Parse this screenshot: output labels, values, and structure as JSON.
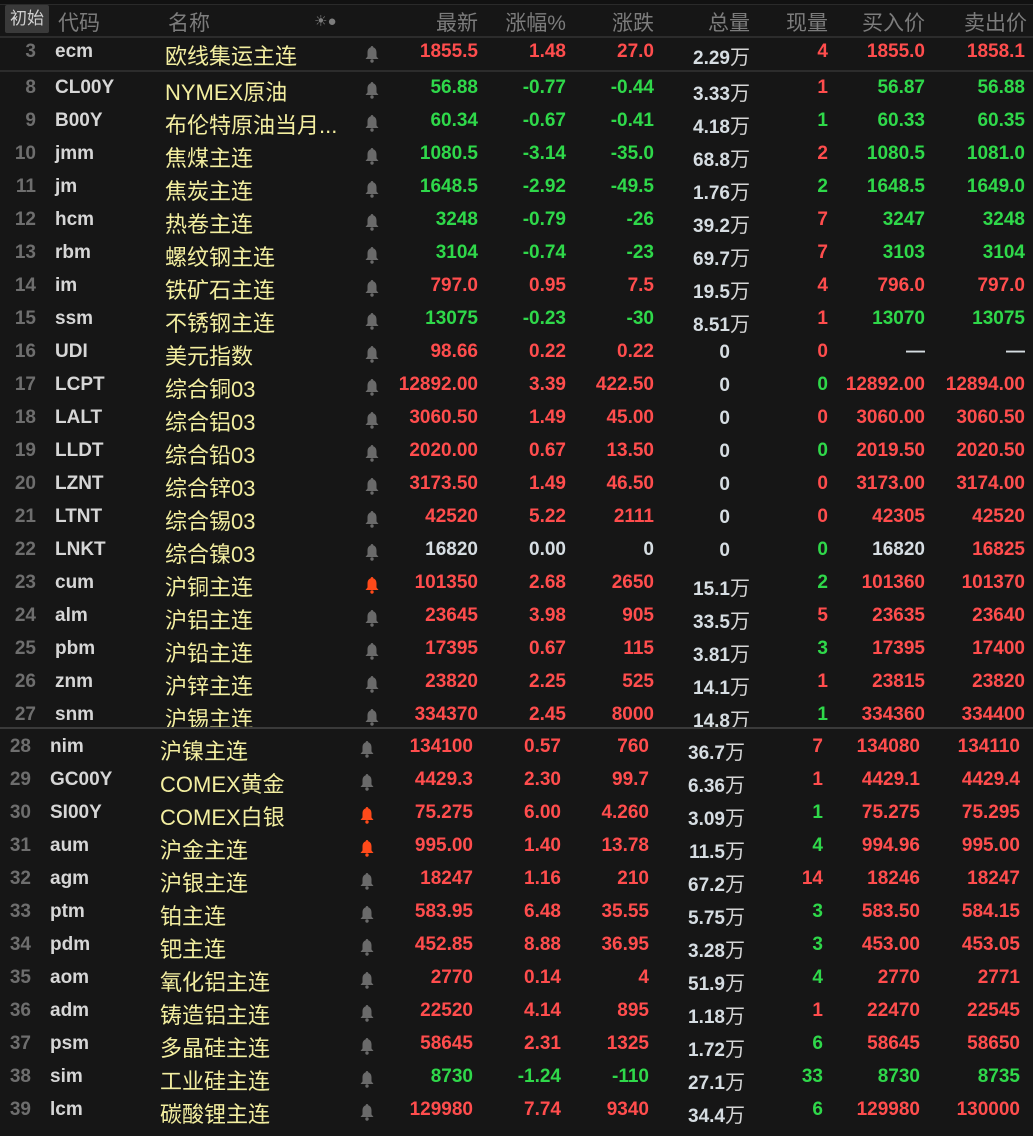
{
  "header": {
    "init_button": "初始",
    "code": "代码",
    "name": "名称",
    "icons": "☀●",
    "last": "最新",
    "pct": "涨幅%",
    "chg": "涨跌",
    "vol": "总量",
    "cur": "现量",
    "bid": "买入价",
    "ask": "卖出价"
  },
  "colors": {
    "up": "#ff4d4d",
    "down": "#2fd84a",
    "flat": "#d6dde2",
    "bell_gray": "#6a6a6a",
    "bell_alert": "#ff4a1a"
  },
  "rows": [
    {
      "idx": "3",
      "code": "ecm",
      "name": "欧线集运主连",
      "bell": "gray",
      "last": "1855.5",
      "pct": "1.48",
      "chg": "27.0",
      "vol": "2.29",
      "unit": "万",
      "cur": "4",
      "bid": "1855.0",
      "ask": "1858.1",
      "c": "rrrrrr"
    },
    {
      "idx": "8",
      "code": "CL00Y",
      "name": "NYMEX原油",
      "bell": "gray",
      "last": "56.88",
      "pct": "-0.77",
      "chg": "-0.44",
      "vol": "3.33",
      "unit": "万",
      "cur": "1",
      "bid": "56.87",
      "ask": "56.88",
      "c": "gggrgg"
    },
    {
      "idx": "9",
      "code": "B00Y",
      "name": "布伦特原油当月...",
      "bell": "gray",
      "last": "60.34",
      "pct": "-0.67",
      "chg": "-0.41",
      "vol": "4.18",
      "unit": "万",
      "cur": "1",
      "bid": "60.33",
      "ask": "60.35",
      "c": "gggggg"
    },
    {
      "idx": "10",
      "code": "jmm",
      "name": "焦煤主连",
      "bell": "gray",
      "last": "1080.5",
      "pct": "-3.14",
      "chg": "-35.0",
      "vol": "68.8",
      "unit": "万",
      "cur": "2",
      "bid": "1080.5",
      "ask": "1081.0",
      "c": "gggrgg"
    },
    {
      "idx": "11",
      "code": "jm",
      "name": "焦炭主连",
      "bell": "gray",
      "last": "1648.5",
      "pct": "-2.92",
      "chg": "-49.5",
      "vol": "1.76",
      "unit": "万",
      "cur": "2",
      "bid": "1648.5",
      "ask": "1649.0",
      "c": "gggggg"
    },
    {
      "idx": "12",
      "code": "hcm",
      "name": "热卷主连",
      "bell": "gray",
      "last": "3248",
      "pct": "-0.79",
      "chg": "-26",
      "vol": "39.2",
      "unit": "万",
      "cur": "7",
      "bid": "3247",
      "ask": "3248",
      "c": "gggrgg"
    },
    {
      "idx": "13",
      "code": "rbm",
      "name": "螺纹钢主连",
      "bell": "gray",
      "last": "3104",
      "pct": "-0.74",
      "chg": "-23",
      "vol": "69.7",
      "unit": "万",
      "cur": "7",
      "bid": "3103",
      "ask": "3104",
      "c": "gggrgg"
    },
    {
      "idx": "14",
      "code": "im",
      "name": "铁矿石主连",
      "bell": "gray",
      "last": "797.0",
      "pct": "0.95",
      "chg": "7.5",
      "vol": "19.5",
      "unit": "万",
      "cur": "4",
      "bid": "796.0",
      "ask": "797.0",
      "c": "rrrrrr"
    },
    {
      "idx": "15",
      "code": "ssm",
      "name": "不锈钢主连",
      "bell": "gray",
      "last": "13075",
      "pct": "-0.23",
      "chg": "-30",
      "vol": "8.51",
      "unit": "万",
      "cur": "1",
      "bid": "13070",
      "ask": "13075",
      "c": "gggrgg"
    },
    {
      "idx": "16",
      "code": "UDI",
      "name": "美元指数",
      "bell": "gray",
      "last": "98.66",
      "pct": "0.22",
      "chg": "0.22",
      "vol": "0",
      "unit": "",
      "cur": "0",
      "bid": "—",
      "ask": "—",
      "c": "rrrrww"
    },
    {
      "idx": "17",
      "code": "LCPT",
      "name": "综合铜03",
      "bell": "gray",
      "last": "12892.00",
      "pct": "3.39",
      "chg": "422.50",
      "vol": "0",
      "unit": "",
      "cur": "0",
      "bid": "12892.00",
      "ask": "12894.00",
      "c": "rrrgrr"
    },
    {
      "idx": "18",
      "code": "LALT",
      "name": "综合铝03",
      "bell": "gray",
      "last": "3060.50",
      "pct": "1.49",
      "chg": "45.00",
      "vol": "0",
      "unit": "",
      "cur": "0",
      "bid": "3060.00",
      "ask": "3060.50",
      "c": "rrrrrr"
    },
    {
      "idx": "19",
      "code": "LLDT",
      "name": "综合铅03",
      "bell": "gray",
      "last": "2020.00",
      "pct": "0.67",
      "chg": "13.50",
      "vol": "0",
      "unit": "",
      "cur": "0",
      "bid": "2019.50",
      "ask": "2020.50",
      "c": "rrrgrr"
    },
    {
      "idx": "20",
      "code": "LZNT",
      "name": "综合锌03",
      "bell": "gray",
      "last": "3173.50",
      "pct": "1.49",
      "chg": "46.50",
      "vol": "0",
      "unit": "",
      "cur": "0",
      "bid": "3173.00",
      "ask": "3174.00",
      "c": "rrrrrr"
    },
    {
      "idx": "21",
      "code": "LTNT",
      "name": "综合锡03",
      "bell": "gray",
      "last": "42520",
      "pct": "5.22",
      "chg": "2111",
      "vol": "0",
      "unit": "",
      "cur": "0",
      "bid": "42305",
      "ask": "42520",
      "c": "rrrrrr"
    },
    {
      "idx": "22",
      "code": "LNKT",
      "name": "综合镍03",
      "bell": "gray",
      "last": "16820",
      "pct": "0.00",
      "chg": "0",
      "vol": "0",
      "unit": "",
      "cur": "0",
      "bid": "16820",
      "ask": "16825",
      "c": "wwwgwr"
    },
    {
      "idx": "23",
      "code": "cum",
      "name": "沪铜主连",
      "bell": "alert",
      "last": "101350",
      "pct": "2.68",
      "chg": "2650",
      "vol": "15.1",
      "unit": "万",
      "cur": "2",
      "bid": "101360",
      "ask": "101370",
      "c": "rrrgrr"
    },
    {
      "idx": "24",
      "code": "alm",
      "name": "沪铝主连",
      "bell": "gray",
      "last": "23645",
      "pct": "3.98",
      "chg": "905",
      "vol": "33.5",
      "unit": "万",
      "cur": "5",
      "bid": "23635",
      "ask": "23640",
      "c": "rrrrrr"
    },
    {
      "idx": "25",
      "code": "pbm",
      "name": "沪铅主连",
      "bell": "gray",
      "last": "17395",
      "pct": "0.67",
      "chg": "115",
      "vol": "3.81",
      "unit": "万",
      "cur": "3",
      "bid": "17395",
      "ask": "17400",
      "c": "rrrgrr"
    },
    {
      "idx": "26",
      "code": "znm",
      "name": "沪锌主连",
      "bell": "gray",
      "last": "23820",
      "pct": "2.25",
      "chg": "525",
      "vol": "14.1",
      "unit": "万",
      "cur": "1",
      "bid": "23815",
      "ask": "23820",
      "c": "rrrrrr"
    },
    {
      "idx": "27",
      "code": "snm",
      "name": "沪锡主连",
      "bell": "gray",
      "last": "334370",
      "pct": "2.45",
      "chg": "8000",
      "vol": "14.8",
      "unit": "万",
      "cur": "1",
      "bid": "334360",
      "ask": "334400",
      "c": "rrrgrr"
    },
    {
      "idx": "28",
      "code": "nim",
      "name": "沪镍主连",
      "bell": "gray",
      "last": "134100",
      "pct": "0.57",
      "chg": "760",
      "vol": "36.7",
      "unit": "万",
      "cur": "7",
      "bid": "134080",
      "ask": "134110",
      "c": "rrrrrr"
    },
    {
      "idx": "29",
      "code": "GC00Y",
      "name": "COMEX黄金",
      "bell": "gray",
      "last": "4429.3",
      "pct": "2.30",
      "chg": "99.7",
      "vol": "6.36",
      "unit": "万",
      "cur": "1",
      "bid": "4429.1",
      "ask": "4429.4",
      "c": "rrrrrr"
    },
    {
      "idx": "30",
      "code": "SI00Y",
      "name": "COMEX白银",
      "bell": "alert",
      "last": "75.275",
      "pct": "6.00",
      "chg": "4.260",
      "vol": "3.09",
      "unit": "万",
      "cur": "1",
      "bid": "75.275",
      "ask": "75.295",
      "c": "rrrgrr"
    },
    {
      "idx": "31",
      "code": "aum",
      "name": "沪金主连",
      "bell": "alert",
      "last": "995.00",
      "pct": "1.40",
      "chg": "13.78",
      "vol": "11.5",
      "unit": "万",
      "cur": "4",
      "bid": "994.96",
      "ask": "995.00",
      "c": "rrrgrr"
    },
    {
      "idx": "32",
      "code": "agm",
      "name": "沪银主连",
      "bell": "gray",
      "last": "18247",
      "pct": "1.16",
      "chg": "210",
      "vol": "67.2",
      "unit": "万",
      "cur": "14",
      "bid": "18246",
      "ask": "18247",
      "c": "rrrrrr"
    },
    {
      "idx": "33",
      "code": "ptm",
      "name": "铂主连",
      "bell": "gray",
      "last": "583.95",
      "pct": "6.48",
      "chg": "35.55",
      "vol": "5.75",
      "unit": "万",
      "cur": "3",
      "bid": "583.50",
      "ask": "584.15",
      "c": "rrrgrr"
    },
    {
      "idx": "34",
      "code": "pdm",
      "name": "钯主连",
      "bell": "gray",
      "last": "452.85",
      "pct": "8.88",
      "chg": "36.95",
      "vol": "3.28",
      "unit": "万",
      "cur": "3",
      "bid": "453.00",
      "ask": "453.05",
      "c": "rrrgrr"
    },
    {
      "idx": "35",
      "code": "aom",
      "name": "氧化铝主连",
      "bell": "gray",
      "last": "2770",
      "pct": "0.14",
      "chg": "4",
      "vol": "51.9",
      "unit": "万",
      "cur": "4",
      "bid": "2770",
      "ask": "2771",
      "c": "rrrgrr"
    },
    {
      "idx": "36",
      "code": "adm",
      "name": "铸造铝主连",
      "bell": "gray",
      "last": "22520",
      "pct": "4.14",
      "chg": "895",
      "vol": "1.18",
      "unit": "万",
      "cur": "1",
      "bid": "22470",
      "ask": "22545",
      "c": "rrrrrr"
    },
    {
      "idx": "37",
      "code": "psm",
      "name": "多晶硅主连",
      "bell": "gray",
      "last": "58645",
      "pct": "2.31",
      "chg": "1325",
      "vol": "1.72",
      "unit": "万",
      "cur": "6",
      "bid": "58645",
      "ask": "58650",
      "c": "rrrgrr"
    },
    {
      "idx": "38",
      "code": "sim",
      "name": "工业硅主连",
      "bell": "gray",
      "last": "8730",
      "pct": "-1.24",
      "chg": "-110",
      "vol": "27.1",
      "unit": "万",
      "cur": "33",
      "bid": "8730",
      "ask": "8735",
      "c": "gggggg"
    },
    {
      "idx": "39",
      "code": "lcm",
      "name": "碳酸锂主连",
      "bell": "gray",
      "last": "129980",
      "pct": "7.74",
      "chg": "9340",
      "vol": "34.4",
      "unit": "万",
      "cur": "6",
      "bid": "129980",
      "ask": "130000",
      "c": "rrrgrr"
    }
  ]
}
